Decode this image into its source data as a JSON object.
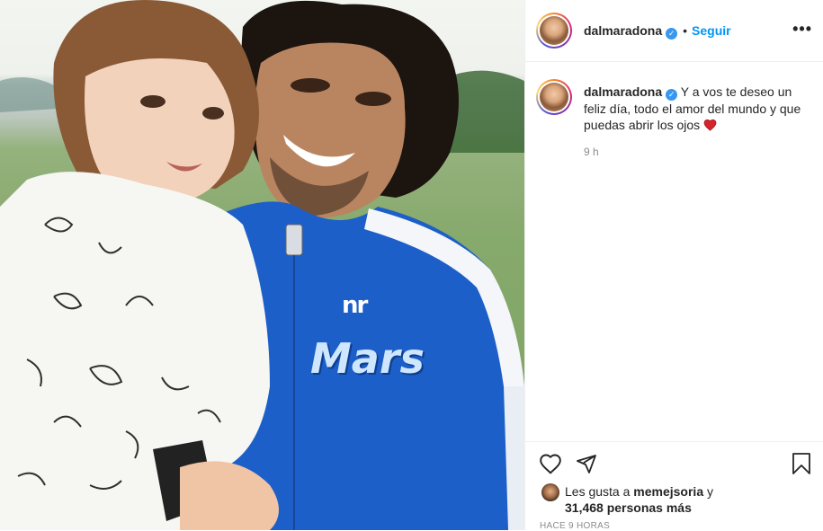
{
  "photo": {
    "alt_subject": "father-and-daughter-photo",
    "jacket_logo": "Mars",
    "jacket_badge": "nr"
  },
  "header": {
    "username": "dalmaradona",
    "separator": "•",
    "follow_label": "Seguir",
    "more_label": "•••"
  },
  "caption": {
    "username": "dalmaradona",
    "text": "Y a vos te deseo un feliz día, todo el amor del mundo y que puedas abrir los ojos",
    "time": "9 h"
  },
  "actions": {
    "icons": [
      "heart-icon",
      "share-icon",
      "bookmark-icon"
    ]
  },
  "likes": {
    "prefix": "Les gusta a ",
    "user": "memejsoria",
    "mid": " y",
    "count": "31,468 personas más"
  },
  "posted_ago": "HACE 9 HORAS",
  "colors": {
    "accent": "#0095f6",
    "verified": "#3897f0",
    "heart": "#ed4956",
    "muted": "#8e8e8e"
  }
}
